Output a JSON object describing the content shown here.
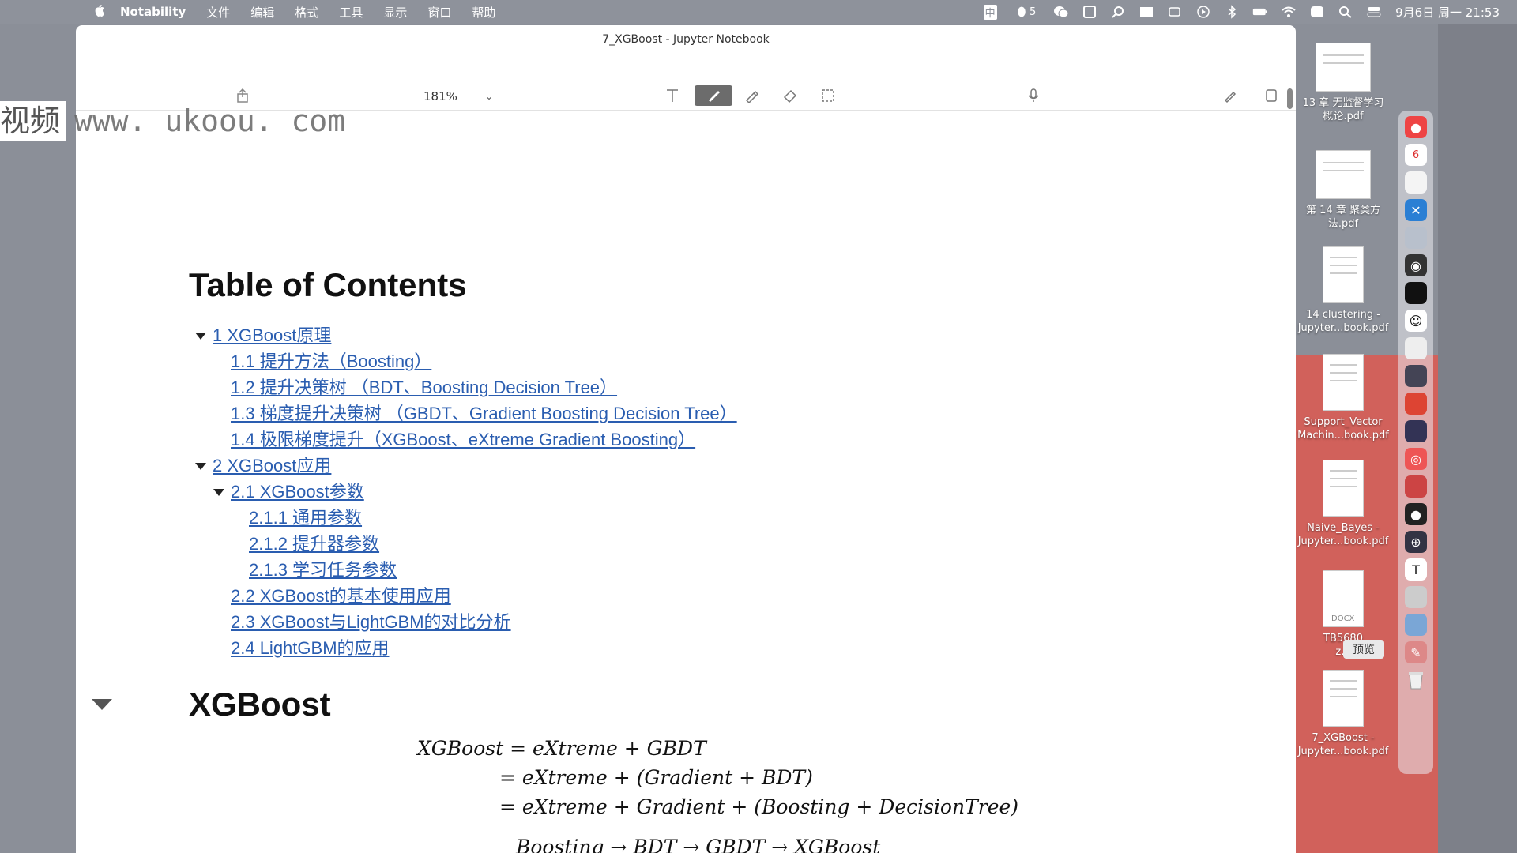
{
  "menubar": {
    "app_name": "Notability",
    "items": [
      "文件",
      "编辑",
      "格式",
      "工具",
      "显示",
      "窗口",
      "帮助"
    ],
    "status": {
      "input_method": "中",
      "notification_count": "5",
      "datetime": "9月6日 周一 21:53"
    }
  },
  "window": {
    "title": "7_XGBoost - Jupyter Notebook",
    "zoom": "181%"
  },
  "watermark": {
    "left_text": "视频",
    "url": "www. ukoou. com"
  },
  "toc": {
    "title": "Table of Contents",
    "items": [
      "1  XGBoost原理",
      "1.1  提升方法（Boosting）",
      "1.2  提升决策树 （BDT、Boosting Decision Tree）",
      "1.3  梯度提升决策树 （GBDT、Gradient Boosting Decision Tree）",
      "1.4  极限梯度提升（XGBoost、eXtreme Gradient Boosting）",
      "2  XGBoost应用",
      "2.1  XGBoost参数",
      "2.1.1  通用参数",
      "2.1.2  提升器参数",
      "2.1.3  学习任务参数",
      "2.2  XGBoost的基本使用应用",
      "2.3  XGBoost与LightGBM的对比分析",
      "2.4  LightGBM的应用"
    ]
  },
  "section": {
    "heading": "XGBoost",
    "equations": [
      "XGBoost = eXtreme + GBDT",
      "= eXtreme + (Gradient + BDT)",
      "= eXtreme + Gradient + (Boosting + DecisionTree)",
      "Boosting → BDT → GBDT → XGBoost"
    ]
  },
  "desktop": {
    "files": [
      "13 章 无监督学习\n概论.pdf",
      "第 14 章 聚类方\n法.pdf",
      "14 clustering -\nJupyter...book.pdf",
      "Support_Vector\nMachin...book.pdf",
      "Naive_Bayes -\nJupyter...book.pdf",
      "TB5680\nz...",
      "7_XGBoost -\nJupyter...book.pdf"
    ],
    "thumb_tag": "DOCX",
    "tooltip": "预览"
  }
}
